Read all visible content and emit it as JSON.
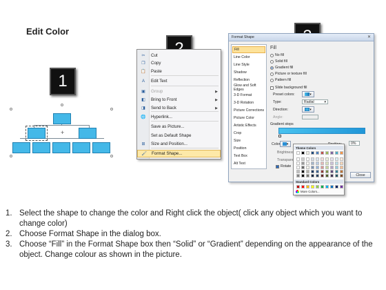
{
  "title": "Edit Color",
  "step_numbers": [
    "1",
    "2",
    "3"
  ],
  "org_chart": {
    "node_color": "#44b8e8",
    "node_border": "#1f7fb0",
    "center_mark": "+"
  },
  "context_menu": {
    "items": [
      {
        "label": "Cut",
        "icon": "scissors-icon",
        "glyph": "✂",
        "disabled": false
      },
      {
        "label": "Copy",
        "icon": "copy-icon",
        "glyph": "❐",
        "disabled": false
      },
      {
        "label": "Paste",
        "icon": "paste-icon",
        "glyph": "📋",
        "disabled": false
      },
      {
        "label": "Edit Text",
        "icon": "edit-text-icon",
        "glyph": "A",
        "disabled": false
      },
      {
        "label": "Group",
        "icon": "group-icon",
        "glyph": "▣",
        "disabled": true,
        "submenu": true
      },
      {
        "label": "Bring to Front",
        "icon": "bring-front-icon",
        "glyph": "◧",
        "disabled": false,
        "submenu": true
      },
      {
        "label": "Send to Back",
        "icon": "send-back-icon",
        "glyph": "◨",
        "disabled": false,
        "submenu": true
      },
      {
        "label": "Hyperlink...",
        "icon": "hyperlink-icon",
        "glyph": "🌐",
        "disabled": false
      },
      {
        "label": "Save as Picture...",
        "icon": "",
        "glyph": "",
        "disabled": false
      },
      {
        "label": "Set as Default Shape",
        "icon": "",
        "glyph": "",
        "disabled": false
      },
      {
        "label": "Size and Position...",
        "icon": "size-position-icon",
        "glyph": "⊞",
        "disabled": false
      },
      {
        "label": "Format Shape...",
        "icon": "format-shape-icon",
        "glyph": "🖌",
        "disabled": false,
        "highlight": true
      }
    ]
  },
  "dialog": {
    "title": "Format Shape",
    "close": "✕",
    "categories": [
      "Fill",
      "Line Color",
      "Line Style",
      "Shadow",
      "Reflection",
      "Glow and Soft Edges",
      "3-D Format",
      "3-D Rotation",
      "Picture Corrections",
      "Picture Color",
      "Artistic Effects",
      "Crop",
      "Size",
      "Position",
      "Text Box",
      "Alt Text"
    ],
    "selected_category": "Fill",
    "panel_heading": "Fill",
    "fill_options": [
      {
        "label": "No fill",
        "selected": false
      },
      {
        "label": "Solid fill",
        "selected": false
      },
      {
        "label": "Gradient fill",
        "selected": true
      },
      {
        "label": "Picture or texture fill",
        "selected": false
      },
      {
        "label": "Pattern fill",
        "selected": false
      }
    ],
    "slide_bg_label": "Slide background fill",
    "preset_label": "Preset colors:",
    "type_label": "Type:",
    "type_value": "Radial",
    "direction_label": "Direction:",
    "angle_label": "Angle:",
    "gradient_stops_label": "Gradient stops",
    "color_label": "Color",
    "position_label": "Position:",
    "position_value": "0%",
    "brightness_label": "Brightness",
    "transparency_label": "Transparency",
    "rotate_label": "Rotate",
    "close_button": "Close"
  },
  "palette": {
    "theme_heading": "Theme Colors",
    "standard_heading": "Standard Colors",
    "more_label": "More Colors...",
    "theme_top": [
      "#ffffff",
      "#000000",
      "#eeece1",
      "#1f497d",
      "#4f81bd",
      "#c0504d",
      "#9bbb59",
      "#8064a2",
      "#4bacc6",
      "#f79646"
    ],
    "standard": [
      "#c00000",
      "#ff0000",
      "#ffc000",
      "#ffff00",
      "#92d050",
      "#00b050",
      "#00b0f0",
      "#0070c0",
      "#002060",
      "#7030a0"
    ]
  },
  "steps": [
    {
      "n": "1.",
      "text": "Select the shape to change the color and Right click the object( click any object which you want to change color)"
    },
    {
      "n": "2.",
      "text": "Choose Format Shape in the dialog box."
    },
    {
      "n": "3.",
      "text": "Choose “Fill” in the Format Shape box then “Solid” or “Gradient” depending on the appearance of the object. Change colour as shown in the picture."
    }
  ]
}
